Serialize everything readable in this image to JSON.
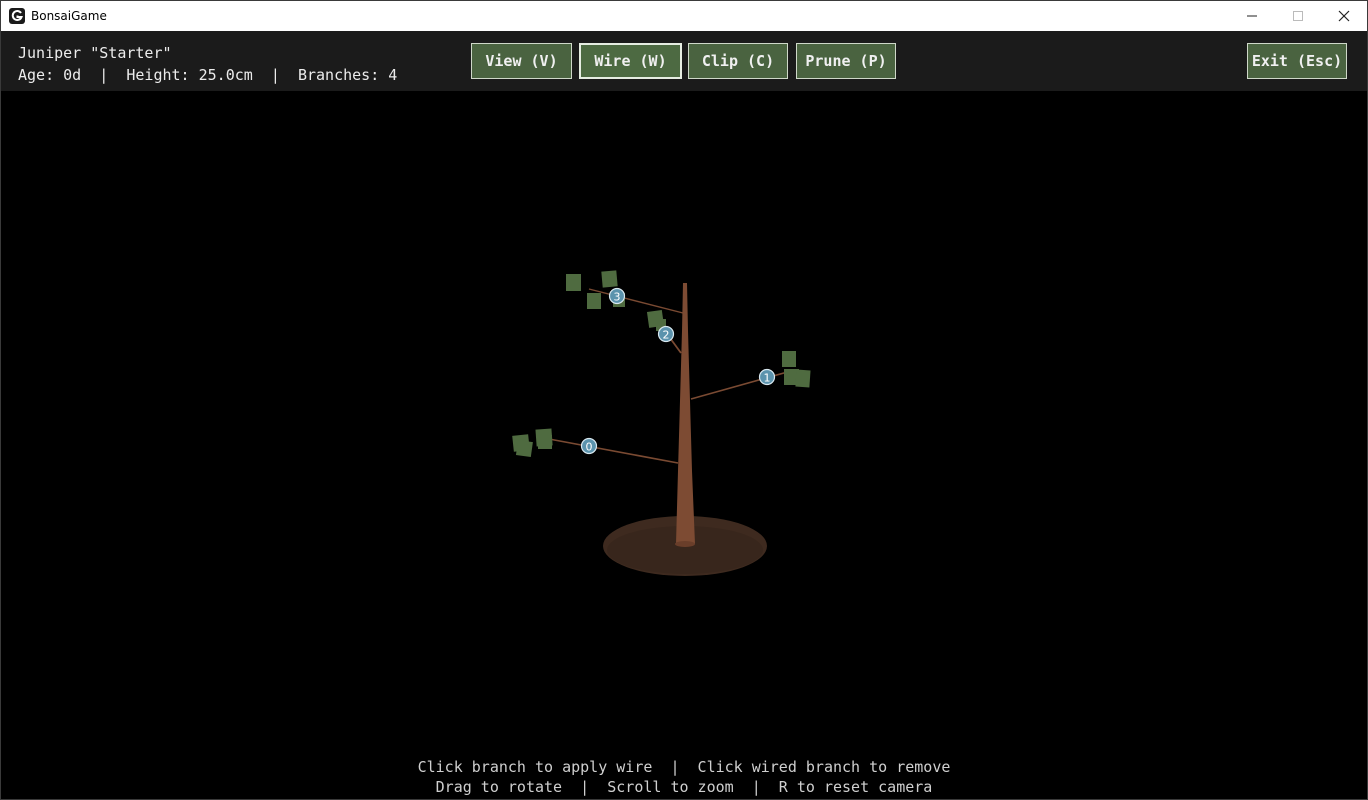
{
  "window": {
    "title": "BonsaiGame",
    "icon": "game-logo-icon",
    "controls": [
      "minimize-icon",
      "maximize-icon",
      "close-icon"
    ]
  },
  "hud": {
    "tree_name": "Juniper \"Starter\"",
    "stats": {
      "age": "Age: 0d",
      "separator": "|",
      "height": "Height: 25.0cm",
      "branches": "Branches: 4"
    }
  },
  "toolbar": {
    "view_label": "View (V)",
    "wire_label": "Wire (W)",
    "clip_label": "Clip (C)",
    "prune_label": "Prune (P)",
    "exit_label": "Exit (Esc)",
    "active_tool": "wire"
  },
  "scene": {
    "branch_markers": [
      "0",
      "1",
      "2",
      "3"
    ]
  },
  "hints": {
    "line1": "Click branch to apply wire  |  Click wired branch to remove",
    "line2": "Drag to rotate  |  Scroll to zoom  |  R to reset camera"
  },
  "colors": {
    "hud_bg": "#1b1b1b",
    "button_bg": "#4a6340",
    "trunk": "#7a4a32",
    "soil": "#3e2a1f",
    "foliage": "#4f6b40",
    "marker": "#5b93ad"
  }
}
